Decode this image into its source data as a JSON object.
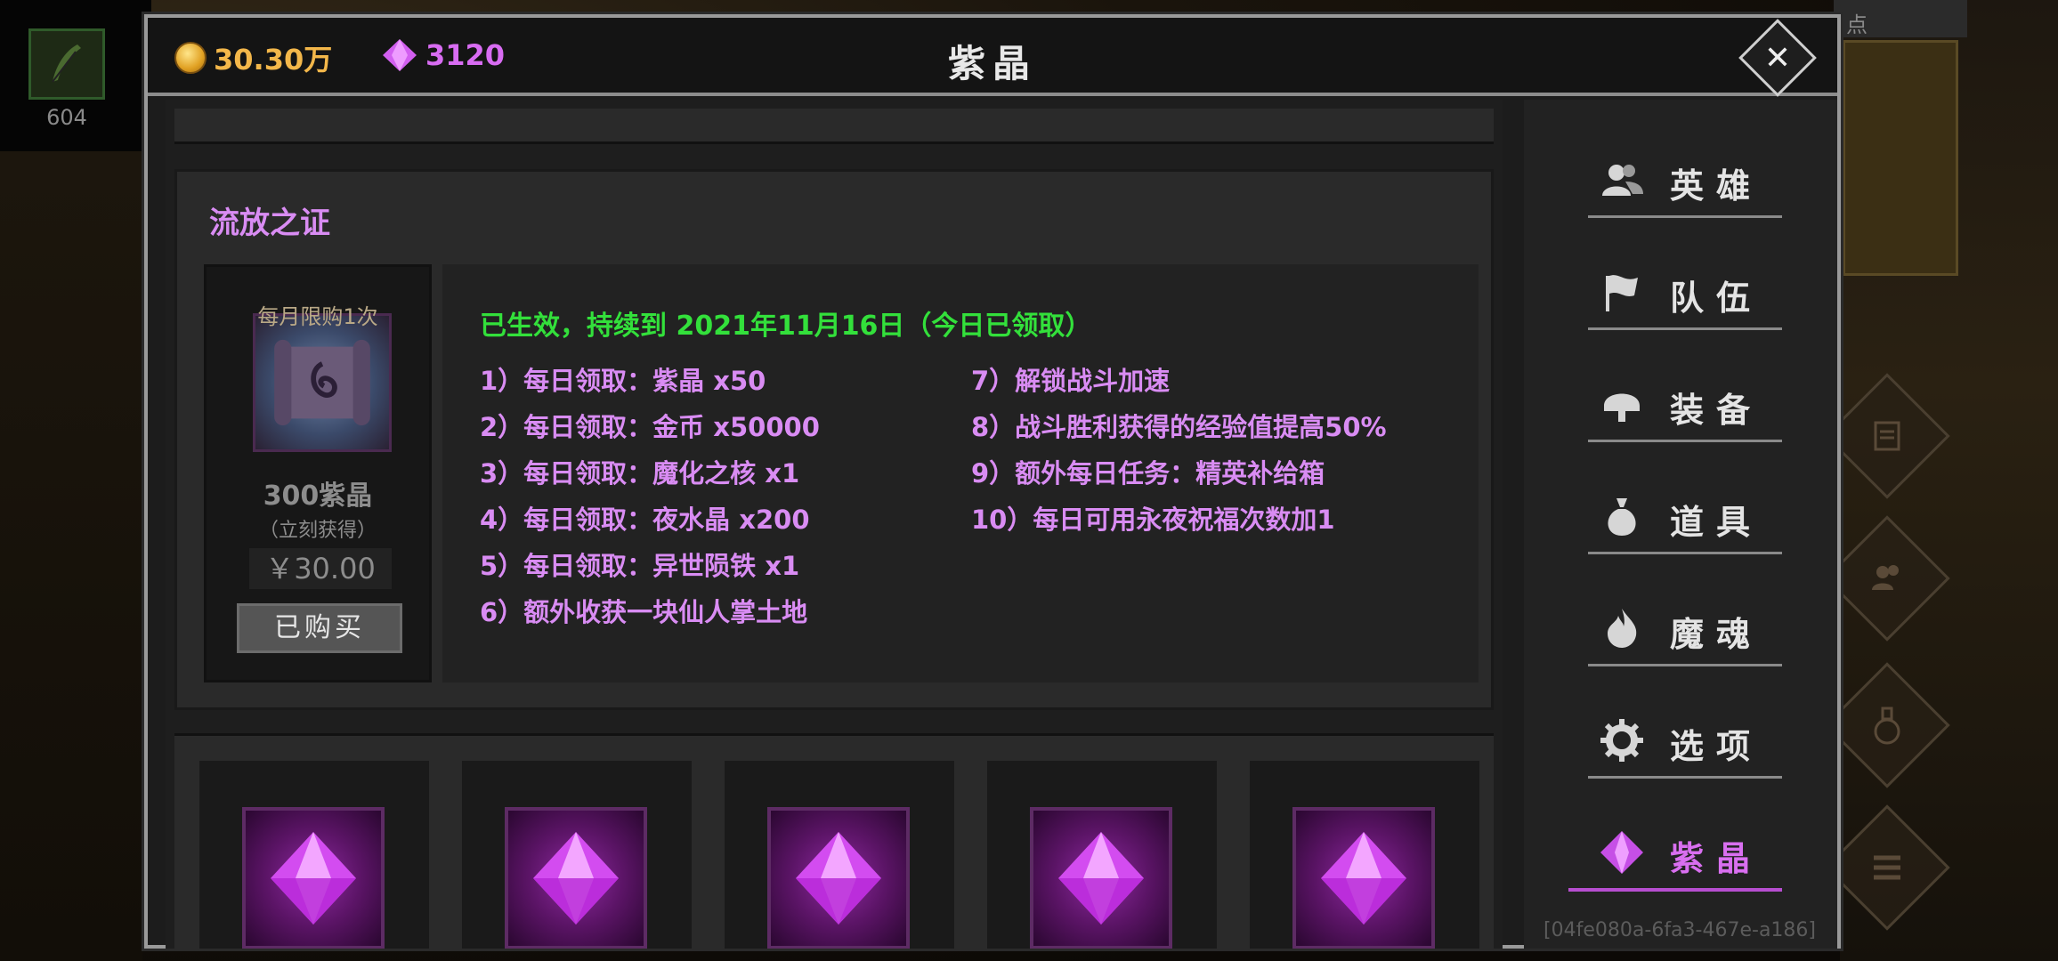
{
  "background": {
    "left_item_count": "604",
    "right_topbar_text": "点"
  },
  "header": {
    "gold": "30.30万",
    "gems": "3120",
    "title": "紫晶",
    "close_symbol": "✕"
  },
  "card": {
    "title": "流放之证",
    "limit_text": "每月限购1次",
    "amount": "300紫晶",
    "amount_note": "（立刻获得）",
    "price": "￥30.00",
    "button_label": "已购买",
    "status": "已生效，持续到 2021年11月16日（今日已领取）",
    "benefits_left": [
      "1）每日领取：紫晶 x50",
      "2）每日领取：金币 x50000",
      "3）每日领取：魔化之核 x1",
      "4）每日领取：夜水晶 x200",
      "5）每日领取：异世陨铁 x1",
      "6）额外收获一块仙人掌土地"
    ],
    "benefits_right": [
      "7）解锁战斗加速",
      "8）战斗胜利获得的经验值提高50%",
      "9）额外每日任务：精英补给箱",
      "10）每日可用永夜祝福次数加1"
    ]
  },
  "sidebar": {
    "items": [
      {
        "label": "英雄",
        "icon": "people-icon"
      },
      {
        "label": "队伍",
        "icon": "flag-icon"
      },
      {
        "label": "装备",
        "icon": "helmet-icon"
      },
      {
        "label": "道具",
        "icon": "bag-icon"
      },
      {
        "label": "魔魂",
        "icon": "flame-icon"
      },
      {
        "label": "选项",
        "icon": "gear-icon"
      },
      {
        "label": "紫晶",
        "icon": "gem-icon",
        "active": true
      }
    ],
    "uuid": "[04fe080a-6fa3-467e-a186]"
  },
  "colors": {
    "accent_purple": "#d98cf3",
    "active_green": "#33e03b",
    "gold": "#f3b74a"
  }
}
